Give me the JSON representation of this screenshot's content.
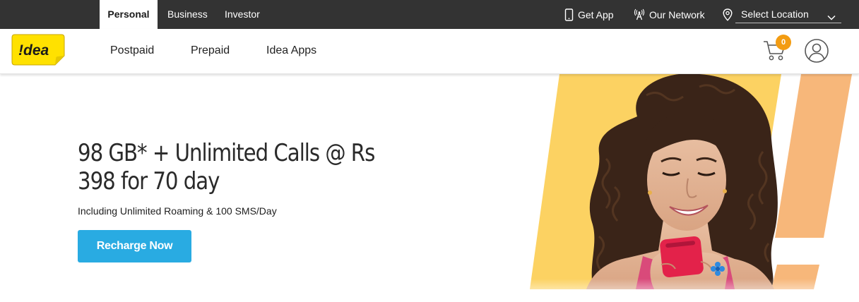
{
  "topbar": {
    "segments": [
      {
        "label": "Personal",
        "active": true
      },
      {
        "label": "Business",
        "active": false
      },
      {
        "label": "Investor",
        "active": false
      }
    ],
    "get_app": {
      "label": "Get App",
      "icon": "phone-icon"
    },
    "network": {
      "label": "Our Network",
      "icon": "tower-icon"
    },
    "location": {
      "label": "Select Location",
      "icon": "map-pin-icon"
    }
  },
  "header": {
    "logo_text": "!dea",
    "nav": [
      "Postpaid",
      "Prepaid",
      "Idea Apps"
    ],
    "cart_count": "0"
  },
  "hero": {
    "headline": "98 GB* + Unlimited Calls @ Rs 398 for 70 day",
    "subline": "Including Unlimited Roaming & 100 SMS/Day",
    "cta": "Recharge Now"
  },
  "colors": {
    "topbar": "#333333",
    "brand_yellow": "#ffe100",
    "cta_blue": "#29abe2",
    "badge_orange": "#f39c12",
    "stripe_yellow": "#fcd262",
    "stripe_orange": "#f7b77a"
  }
}
